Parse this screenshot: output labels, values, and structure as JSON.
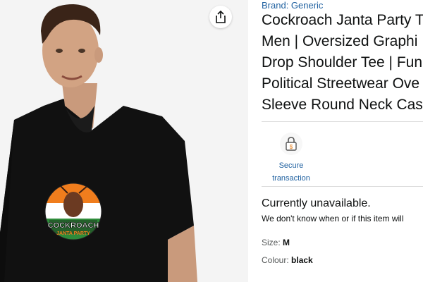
{
  "product": {
    "brand": "Brand: Generic",
    "title_lines": [
      "Cockroach Janta Party T",
      "Men | Oversized Graphi",
      "Drop Shoulder Tee | Fun",
      "Political Streetwear Ove",
      "Sleeve Round Neck Cas"
    ],
    "image": {
      "print_text_line1": "COCKROACH",
      "print_text_line2": "JANTA PARTY",
      "shirt_color": "#111111",
      "print_colors": [
        "#f07d1d",
        "#ffffff",
        "#2e8b3a"
      ]
    }
  },
  "trust": {
    "secure_label_line1": "Secure",
    "secure_label_line2": "transaction",
    "icon": "lock-icon"
  },
  "availability": {
    "status": "Currently unavailable.",
    "note": "We don't know when or if this item will"
  },
  "attributes": {
    "size_label": "Size:",
    "size_value": "M",
    "colour_label": "Colour:",
    "colour_value": "black"
  },
  "actions": {
    "share_icon": "share-icon"
  },
  "colors": {
    "link": "#2162a1",
    "text": "#0f1111",
    "muted": "#565959"
  }
}
